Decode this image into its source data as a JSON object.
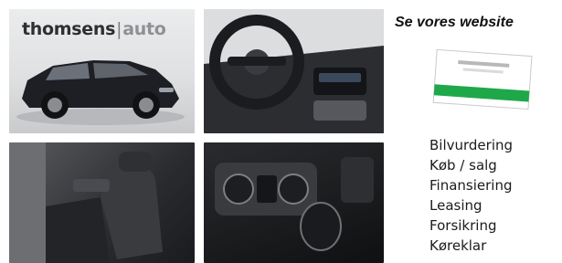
{
  "brand": {
    "name_part1": "thomsens",
    "name_part2": "auto"
  },
  "sidebar": {
    "title": "Se vores website",
    "services": [
      "Bilvurdering",
      "Køb / salg",
      "Finansiering",
      "Leasing",
      "Forsikring",
      "Køreklar"
    ]
  },
  "photos": [
    {
      "subject": "car-exterior"
    },
    {
      "subject": "dashboard"
    },
    {
      "subject": "front-seats"
    },
    {
      "subject": "center-console"
    }
  ],
  "colors": {
    "accent": "#1fa84a",
    "text": "#111111"
  }
}
